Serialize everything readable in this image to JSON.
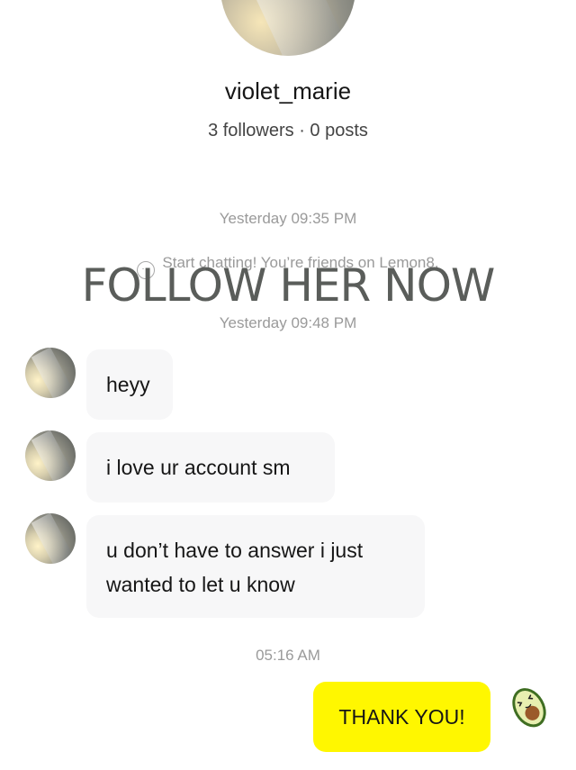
{
  "profile": {
    "username": "violet_marie",
    "stats": "3 followers · 0 posts"
  },
  "timestamps": {
    "first": "Yesterday 09:35 PM",
    "second": "Yesterday 09:48 PM",
    "third": "05:16 AM"
  },
  "system_message": "Start chatting! You’re friends on Lemon8.",
  "overlay_banner": "FOLLOW HER NOW",
  "messages_incoming": [
    {
      "text": "heyy"
    },
    {
      "text": "i love ur account sm"
    },
    {
      "text_line1": "u don’t have to answer i just",
      "text_line2": "wanted to let u know"
    }
  ],
  "messages_outgoing": [
    {
      "text": "THANK YOU!"
    }
  ],
  "icons": {
    "chat": "chat-bubble-icon",
    "self_avatar": "avocado-icon"
  },
  "colors": {
    "outgoing_bubble": "#fff700",
    "incoming_bubble": "#f7f7f8",
    "overlay_text": "#5a5d5a"
  }
}
